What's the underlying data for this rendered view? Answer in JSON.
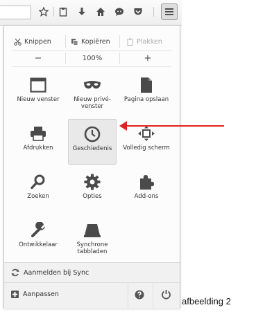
{
  "toolbar": {
    "icons": [
      "star-icon",
      "clipboard-icon",
      "download-icon",
      "home-icon",
      "chat-icon",
      "pocket-icon",
      "hamburger-menu-icon"
    ]
  },
  "edit": {
    "cut": "Knippen",
    "copy": "Kopiëren",
    "paste": "Plakken"
  },
  "zoom": {
    "minus": "−",
    "level": "100%",
    "plus": "+"
  },
  "grid": [
    {
      "label": "Nieuw venster",
      "icon": "new-window-icon"
    },
    {
      "label": "Nieuw privé-venster",
      "icon": "private-mask-icon"
    },
    {
      "label": "Pagina opslaan",
      "icon": "save-page-icon"
    },
    {
      "label": "Afdrukken",
      "icon": "printer-icon"
    },
    {
      "label": "Geschiedenis",
      "icon": "history-clock-icon"
    },
    {
      "label": "Volledig scherm",
      "icon": "fullscreen-icon"
    },
    {
      "label": "Zoeken",
      "icon": "search-icon"
    },
    {
      "label": "Opties",
      "icon": "gear-icon"
    },
    {
      "label": "Add-ons",
      "icon": "puzzle-icon"
    },
    {
      "label": "Ontwikkelaar",
      "icon": "wrench-icon"
    },
    {
      "label": "Synchrone tabbladen",
      "icon": "synced-tabs-icon"
    }
  ],
  "footer": {
    "sync": "Aanmelden bij Sync",
    "customize": "Aanpassen"
  },
  "caption": "afbeelding 2",
  "colors": {
    "arrow": "#e02020",
    "highlight": "#e9e9e9"
  }
}
